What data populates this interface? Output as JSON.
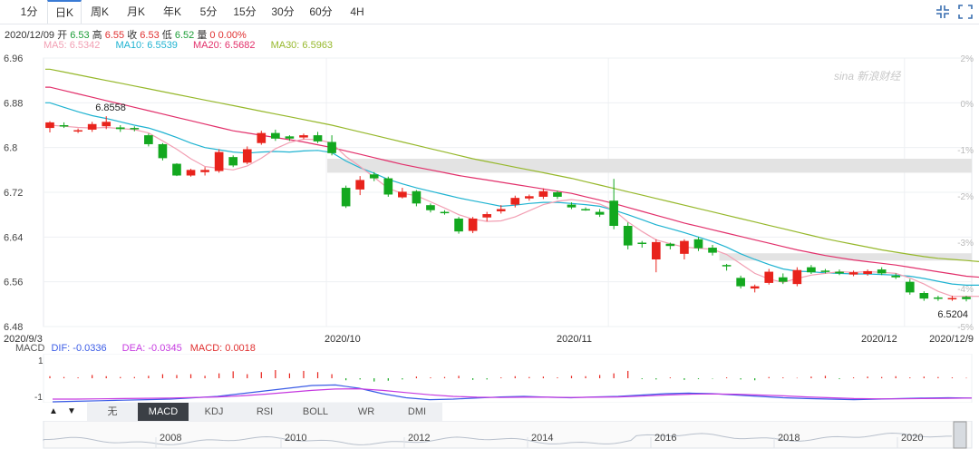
{
  "tabs": [
    {
      "label": "1分",
      "active": false
    },
    {
      "label": "日K",
      "active": true
    },
    {
      "label": "周K",
      "active": false
    },
    {
      "label": "月K",
      "active": false
    },
    {
      "label": "年K",
      "active": false
    },
    {
      "label": "5分",
      "active": false
    },
    {
      "label": "15分",
      "active": false
    },
    {
      "label": "30分",
      "active": false
    },
    {
      "label": "60分",
      "active": false
    },
    {
      "label": "4H",
      "active": false
    }
  ],
  "info": {
    "date": "2020/12/09",
    "open_label": "开",
    "open": "6.53",
    "high_label": "高",
    "high": "6.55",
    "close_label": "收",
    "close": "6.53",
    "low_label": "低",
    "low": "6.52",
    "vol_label": "量",
    "vol": "0",
    "change": "0.00%"
  },
  "ma": {
    "ma5": "MA5: 6.5342",
    "ma10": "MA10: 6.5539",
    "ma20": "MA20: 6.5682",
    "ma30": "MA30: 6.5963"
  },
  "watermark": "新浪财经",
  "colors": {
    "up": "#e8231c",
    "down": "#13a81f",
    "ma5": "#f29fb3",
    "ma10": "#1fb3d1",
    "ma20": "#e2306b",
    "ma30": "#96b82b",
    "dif": "#3b5ce6",
    "dea": "#c63ae0",
    "macd": "#e03030"
  },
  "chart_data": {
    "type": "candlestick",
    "ylim": [
      6.48,
      6.96
    ],
    "yticks": [
      "6.96",
      "6.88",
      "6.8",
      "6.72",
      "6.64",
      "6.56",
      "6.48"
    ],
    "right_ticks": [
      "2%",
      "0%",
      "-1%",
      "-2%",
      "-3%",
      "-4%",
      "-5%"
    ],
    "xticks": [
      "2020/9/3",
      "2020/10",
      "2020/11",
      "2020/12",
      "2020/12/9"
    ],
    "annotations": {
      "high": "6.8558",
      "last": "6.5204"
    },
    "gap_zones": [
      [
        6.755,
        6.78
      ],
      [
        6.598,
        6.611
      ]
    ],
    "candles": [
      [
        6.835,
        6.845,
        6.827,
        6.847
      ],
      [
        6.84,
        6.838,
        6.835,
        6.845
      ],
      [
        6.83,
        6.831,
        6.826,
        6.834
      ],
      [
        6.832,
        6.842,
        6.828,
        6.846
      ],
      [
        6.838,
        6.846,
        6.833,
        6.856
      ],
      [
        6.836,
        6.833,
        6.828,
        6.84
      ],
      [
        6.835,
        6.833,
        6.829,
        6.838
      ],
      [
        6.822,
        6.806,
        6.802,
        6.825
      ],
      [
        6.806,
        6.781,
        6.777,
        6.808
      ],
      [
        6.771,
        6.75,
        6.749,
        6.772
      ],
      [
        6.75,
        6.76,
        6.748,
        6.762
      ],
      [
        6.756,
        6.76,
        6.75,
        6.765
      ],
      [
        6.758,
        6.792,
        6.755,
        6.797
      ],
      [
        6.783,
        6.768,
        6.765,
        6.786
      ],
      [
        6.773,
        6.797,
        6.77,
        6.802
      ],
      [
        6.808,
        6.826,
        6.805,
        6.83
      ],
      [
        6.826,
        6.816,
        6.812,
        6.832
      ],
      [
        6.82,
        6.816,
        6.812,
        6.822
      ],
      [
        6.818,
        6.822,
        6.815,
        6.825
      ],
      [
        6.822,
        6.811,
        6.808,
        6.828
      ],
      [
        6.81,
        6.79,
        6.786,
        6.822
      ],
      [
        6.728,
        6.695,
        6.692,
        6.732
      ],
      [
        6.725,
        6.742,
        6.715,
        6.749
      ],
      [
        6.752,
        6.745,
        6.74,
        6.756
      ],
      [
        6.745,
        6.716,
        6.712,
        6.748
      ],
      [
        6.711,
        6.721,
        6.709,
        6.728
      ],
      [
        6.722,
        6.7,
        6.695,
        6.724
      ],
      [
        6.697,
        6.688,
        6.684,
        6.7
      ],
      [
        6.685,
        6.683,
        6.68,
        6.688
      ],
      [
        6.673,
        6.65,
        6.646,
        6.676
      ],
      [
        6.651,
        6.673,
        6.647,
        6.676
      ],
      [
        6.675,
        6.681,
        6.668,
        6.685
      ],
      [
        6.686,
        6.69,
        6.682,
        6.697
      ],
      [
        6.698,
        6.71,
        6.693,
        6.714
      ],
      [
        6.709,
        6.713,
        6.705,
        6.716
      ],
      [
        6.712,
        6.722,
        6.708,
        6.727
      ],
      [
        6.72,
        6.712,
        6.708,
        6.723
      ],
      [
        6.698,
        6.693,
        6.69,
        6.702
      ],
      [
        6.69,
        6.689,
        6.687,
        6.693
      ],
      [
        6.685,
        6.68,
        6.676,
        6.69
      ],
      [
        6.705,
        6.66,
        6.654,
        6.744
      ],
      [
        6.66,
        6.625,
        6.618,
        6.666
      ],
      [
        6.63,
        6.628,
        6.621,
        6.633
      ],
      [
        6.6,
        6.631,
        6.577,
        6.636
      ],
      [
        6.628,
        6.624,
        6.618,
        6.63
      ],
      [
        6.61,
        6.633,
        6.6,
        6.636
      ],
      [
        6.636,
        6.62,
        6.615,
        6.64
      ],
      [
        6.621,
        6.612,
        6.607,
        6.626
      ],
      [
        6.59,
        6.588,
        6.58,
        6.592
      ],
      [
        6.567,
        6.552,
        6.548,
        6.571
      ],
      [
        6.548,
        6.552,
        6.541,
        6.555
      ],
      [
        6.558,
        6.578,
        6.555,
        6.583
      ],
      [
        6.568,
        6.56,
        6.556,
        6.575
      ],
      [
        6.556,
        6.581,
        6.552,
        6.586
      ],
      [
        6.586,
        6.577,
        6.574,
        6.59
      ],
      [
        6.58,
        6.579,
        6.575,
        6.583
      ],
      [
        6.578,
        6.575,
        6.572,
        6.582
      ],
      [
        6.573,
        6.577,
        6.57,
        6.58
      ],
      [
        6.574,
        6.579,
        6.571,
        6.582
      ],
      [
        6.582,
        6.575,
        6.572,
        6.586
      ],
      [
        6.571,
        6.568,
        6.565,
        6.575
      ],
      [
        6.56,
        6.541,
        6.537,
        6.565
      ],
      [
        6.54,
        6.53,
        6.526,
        6.543
      ],
      [
        6.532,
        6.53,
        6.526,
        6.535
      ],
      [
        6.53,
        6.531,
        6.526,
        6.535
      ],
      [
        6.533,
        6.529,
        6.525,
        6.535
      ]
    ],
    "ma_lines": {
      "ma5": [
        6.84,
        6.838,
        6.836,
        6.835,
        6.836,
        6.834,
        6.832,
        6.826,
        6.812,
        6.797,
        6.78,
        6.766,
        6.763,
        6.76,
        6.767,
        6.781,
        6.798,
        6.809,
        6.815,
        6.814,
        6.808,
        6.784,
        6.766,
        6.747,
        6.727,
        6.718,
        6.714,
        6.703,
        6.692,
        6.68,
        6.672,
        6.668,
        6.669,
        6.676,
        6.687,
        6.698,
        6.704,
        6.707,
        6.704,
        6.699,
        6.688,
        6.667,
        6.65,
        6.635,
        6.628,
        6.622,
        6.62,
        6.618,
        6.609,
        6.592,
        6.575,
        6.565,
        6.559,
        6.566,
        6.572,
        6.575,
        6.578,
        6.577,
        6.578,
        6.577,
        6.575,
        6.567,
        6.556,
        6.543,
        6.534,
        6.534,
        6.534
      ],
      "ma10": [
        6.88,
        6.872,
        6.864,
        6.857,
        6.852,
        6.846,
        6.84,
        6.835,
        6.827,
        6.818,
        6.808,
        6.8,
        6.796,
        6.792,
        6.79,
        6.792,
        6.793,
        6.792,
        6.794,
        6.795,
        6.791,
        6.776,
        6.764,
        6.754,
        6.743,
        6.735,
        6.728,
        6.722,
        6.716,
        6.71,
        6.705,
        6.7,
        6.695,
        6.697,
        6.7,
        6.702,
        6.702,
        6.7,
        6.698,
        6.695,
        6.688,
        6.68,
        6.671,
        6.662,
        6.655,
        6.648,
        6.64,
        6.632,
        6.622,
        6.61,
        6.6,
        6.591,
        6.583,
        6.579,
        6.578,
        6.576,
        6.575,
        6.574,
        6.574,
        6.573,
        6.572,
        6.57,
        6.566,
        6.561,
        6.556,
        6.554,
        6.554
      ],
      "ma20": [
        6.908,
        6.902,
        6.896,
        6.89,
        6.884,
        6.878,
        6.872,
        6.866,
        6.86,
        6.854,
        6.848,
        6.842,
        6.836,
        6.83,
        6.826,
        6.822,
        6.818,
        6.814,
        6.81,
        6.805,
        6.8,
        6.794,
        6.788,
        6.782,
        6.776,
        6.77,
        6.765,
        6.76,
        6.755,
        6.75,
        6.746,
        6.742,
        6.738,
        6.734,
        6.73,
        6.726,
        6.722,
        6.718,
        6.712,
        6.706,
        6.7,
        6.693,
        6.686,
        6.679,
        6.672,
        6.665,
        6.659,
        6.653,
        6.647,
        6.641,
        6.635,
        6.629,
        6.623,
        6.617,
        6.612,
        6.607,
        6.603,
        6.599,
        6.596,
        6.593,
        6.59,
        6.586,
        6.582,
        6.578,
        6.574,
        6.57,
        6.568
      ],
      "ma30": [
        6.94,
        6.935,
        6.93,
        6.925,
        6.92,
        6.915,
        6.91,
        6.905,
        6.9,
        6.895,
        6.89,
        6.885,
        6.88,
        6.875,
        6.87,
        6.865,
        6.86,
        6.855,
        6.85,
        6.845,
        6.84,
        6.834,
        6.828,
        6.822,
        6.816,
        6.81,
        6.804,
        6.798,
        6.792,
        6.786,
        6.78,
        6.775,
        6.77,
        6.765,
        6.76,
        6.755,
        6.75,
        6.745,
        6.739,
        6.733,
        6.727,
        6.721,
        6.715,
        6.709,
        6.703,
        6.697,
        6.691,
        6.685,
        6.679,
        6.673,
        6.667,
        6.661,
        6.655,
        6.649,
        6.643,
        6.637,
        6.632,
        6.627,
        6.622,
        6.617,
        6.613,
        6.609,
        6.605,
        6.602,
        6.6,
        6.598,
        6.596
      ]
    },
    "macd_labels": {
      "title": "MACD",
      "dif": "DIF: -0.0336",
      "dea": "DEA: -0.0345",
      "macd": "MACD: 0.0018",
      "y_top": "1",
      "y_bottom": "-1"
    },
    "macd_bars": [
      0.05,
      0.03,
      0.02,
      0.08,
      0.05,
      0.03,
      0.03,
      0.06,
      0.1,
      0.08,
      0.1,
      0.06,
      0.12,
      0.17,
      0.1,
      0.15,
      0.2,
      0.12,
      0.18,
      0.15,
      0.1,
      -0.05,
      -0.03,
      -0.08,
      -0.06,
      -0.03,
      0.04,
      0.02,
      0.03,
      0.06,
      -0.04,
      -0.03,
      0.02,
      0.05,
      0.03,
      0.04,
      0.02,
      0.06,
      0.05,
      0.08,
      0.12,
      0.18,
      -0.02,
      -0.03,
      0.02,
      -0.04,
      -0.02,
      -0.01,
      0.02,
      -0.03,
      -0.05,
      0.03,
      0.02,
      0.01,
      0.04,
      0.06,
      -0.02,
      0.02,
      0.04,
      0.03,
      0.05,
      0.02,
      0.04,
      0.03,
      0.02,
      0.01,
      0.02
    ],
    "dif": [
      -0.2,
      -0.18,
      -0.16,
      -0.14,
      -0.12,
      -0.1,
      -0.05,
      0.0,
      0.1,
      0.2,
      0.3,
      0.4,
      0.42,
      0.3,
      0.1,
      -0.05,
      -0.12,
      -0.1,
      -0.06,
      -0.02,
      0.0,
      -0.03,
      -0.05,
      -0.02,
      0.0,
      0.05,
      0.1,
      0.12,
      0.1,
      0.05,
      0.0,
      -0.05,
      -0.08,
      -0.1,
      -0.12,
      -0.1,
      -0.08,
      -0.06,
      -0.05,
      -0.06
    ],
    "dea": [
      -0.1,
      -0.1,
      -0.09,
      -0.08,
      -0.07,
      -0.06,
      -0.04,
      -0.02,
      0.02,
      0.08,
      0.15,
      0.22,
      0.27,
      0.28,
      0.22,
      0.14,
      0.06,
      0.0,
      -0.03,
      -0.04,
      -0.03,
      -0.03,
      -0.04,
      -0.03,
      -0.02,
      0.01,
      0.05,
      0.08,
      0.09,
      0.08,
      0.05,
      0.02,
      -0.02,
      -0.05,
      -0.08,
      -0.09,
      -0.09,
      -0.08,
      -0.07,
      -0.06
    ],
    "nav_xticks": [
      "2008",
      "2010",
      "2012",
      "2014",
      "2016",
      "2018",
      "2020"
    ]
  },
  "indicator_tabs": [
    {
      "label": "无",
      "active": false
    },
    {
      "label": "MACD",
      "active": true
    },
    {
      "label": "KDJ",
      "active": false
    },
    {
      "label": "RSI",
      "active": false
    },
    {
      "label": "BOLL",
      "active": false
    },
    {
      "label": "WR",
      "active": false
    },
    {
      "label": "DMI",
      "active": false
    }
  ]
}
